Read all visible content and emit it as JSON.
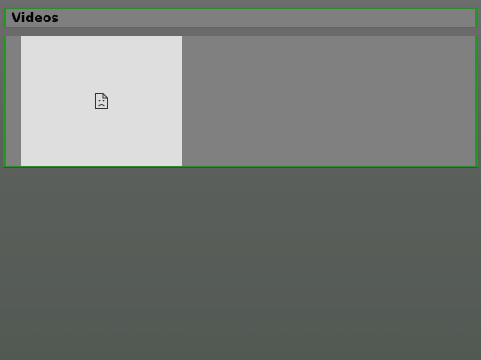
{
  "header": {
    "title": "Videos"
  },
  "videos": {
    "items": [
      {
        "thumbnail_icon": "broken-image-icon"
      }
    ]
  },
  "colors": {
    "accent_border": "#1f9a1f",
    "panel_background": "#808080",
    "thumbnail_background": "#dedede"
  }
}
